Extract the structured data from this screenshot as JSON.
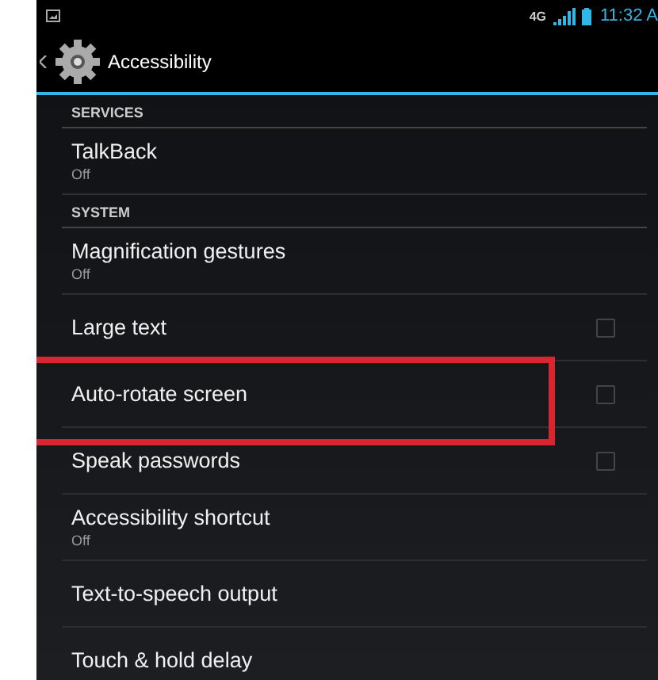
{
  "status_bar": {
    "time": "11:32 A",
    "network": "4G"
  },
  "action_bar": {
    "title": "Accessibility"
  },
  "items": [
    {
      "kind": "header",
      "label": "SERVICES"
    },
    {
      "kind": "entry",
      "title": "TalkBack",
      "summary": "Off",
      "highlighted": false
    },
    {
      "kind": "header",
      "label": "SYSTEM"
    },
    {
      "kind": "entry",
      "title": "Magnification gestures",
      "summary": "Off",
      "highlighted": false
    },
    {
      "kind": "check",
      "title": "Large text",
      "checked": false,
      "highlighted": false
    },
    {
      "kind": "check",
      "title": "Auto-rotate screen",
      "checked": false,
      "highlighted": true
    },
    {
      "kind": "check",
      "title": "Speak passwords",
      "checked": false,
      "highlighted": false
    },
    {
      "kind": "entry",
      "title": "Accessibility shortcut",
      "summary": "Off",
      "highlighted": false
    },
    {
      "kind": "entry",
      "title": "Text-to-speech output",
      "highlighted": false
    },
    {
      "kind": "entry",
      "title": "Touch & hold delay",
      "highlighted": false
    }
  ]
}
